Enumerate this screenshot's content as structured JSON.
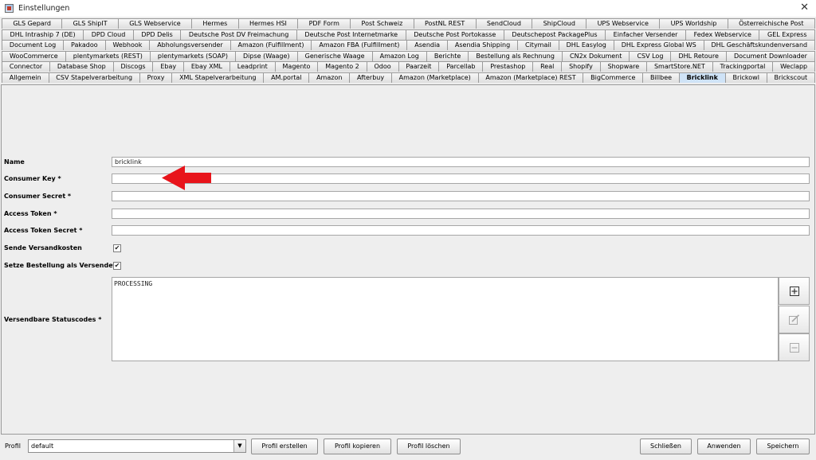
{
  "window": {
    "title": "Einstellungen",
    "close": "✕"
  },
  "tabs": {
    "row1": [
      "GLS Gepard",
      "GLS ShipIT",
      "GLS Webservice",
      "Hermes",
      "Hermes HSI",
      "PDF Form",
      "Post Schweiz",
      "PostNL REST",
      "SendCloud",
      "ShipCloud",
      "UPS Webservice",
      "UPS Worldship",
      "Österreichische Post"
    ],
    "row2": [
      "DHL Intraship 7 (DE)",
      "DPD Cloud",
      "DPD Delis",
      "Deutsche Post DV Freimachung",
      "Deutsche Post Internetmarke",
      "Deutsche Post Portokasse",
      "Deutschepost PackagePlus",
      "Einfacher Versender",
      "Fedex Webservice",
      "GEL Express"
    ],
    "row3": [
      "Document Log",
      "Pakadoo",
      "Webhook",
      "Abholungsversender",
      "Amazon (Fulfillment)",
      "Amazon FBA (Fulfillment)",
      "Asendia",
      "Asendia Shipping",
      "Citymail",
      "DHL Easylog",
      "DHL Express Global WS",
      "DHL Geschäftskundenversand"
    ],
    "row4": [
      "WooCommerce",
      "plentymarkets (REST)",
      "plentymarkets (SOAP)",
      "Dipse (Waage)",
      "Generische Waage",
      "Amazon Log",
      "Berichte",
      "Bestellung als Rechnung",
      "CN2x Dokument",
      "CSV Log",
      "DHL Retoure",
      "Document Downloader"
    ],
    "row5": [
      "Connector",
      "Database Shop",
      "Discogs",
      "Ebay",
      "Ebay XML",
      "Leadprint",
      "Magento",
      "Magento 2",
      "Odoo",
      "Paarzeit",
      "Parcellab",
      "Prestashop",
      "Real",
      "Shopify",
      "Shopware",
      "SmartStore.NET",
      "Trackingportal",
      "Weclapp"
    ],
    "row6": [
      "Allgemein",
      "CSV Stapelverarbeitung",
      "Proxy",
      "XML Stapelverarbeitung",
      "AM.portal",
      "Amazon",
      "Afterbuy",
      "Amazon (Marketplace)",
      "Amazon (Marketplace) REST",
      "BigCommerce",
      "Billbee",
      "Bricklink",
      "Brickowl",
      "Brickscout"
    ],
    "active": "Bricklink"
  },
  "form": {
    "name_label": "Name",
    "name_value": "bricklink",
    "consumer_key_label": "Consumer Key *",
    "consumer_key_value": "",
    "consumer_secret_label": "Consumer Secret *",
    "consumer_secret_value": "",
    "access_token_label": "Access Token *",
    "access_token_value": "",
    "access_token_secret_label": "Access Token Secret *",
    "access_token_secret_value": "",
    "send_shipping_label": "Sende Versandkosten",
    "send_shipping_checked": true,
    "set_order_shipped_label": "Setze Bestellung als Versendet",
    "set_order_shipped_checked": true,
    "status_codes_label": "Versendbare Statuscodes *",
    "status_codes_value": "PROCESSING"
  },
  "bottom": {
    "profile_label": "Profil",
    "profile_value": "default",
    "create_profile": "Profil erstellen",
    "copy_profile": "Profil kopieren",
    "delete_profile": "Profil löschen",
    "close": "Schließen",
    "apply": "Anwenden",
    "save": "Speichern"
  },
  "colors": {
    "annotation_arrow": "#e8141b",
    "active_tab": "#cfe3f7"
  }
}
